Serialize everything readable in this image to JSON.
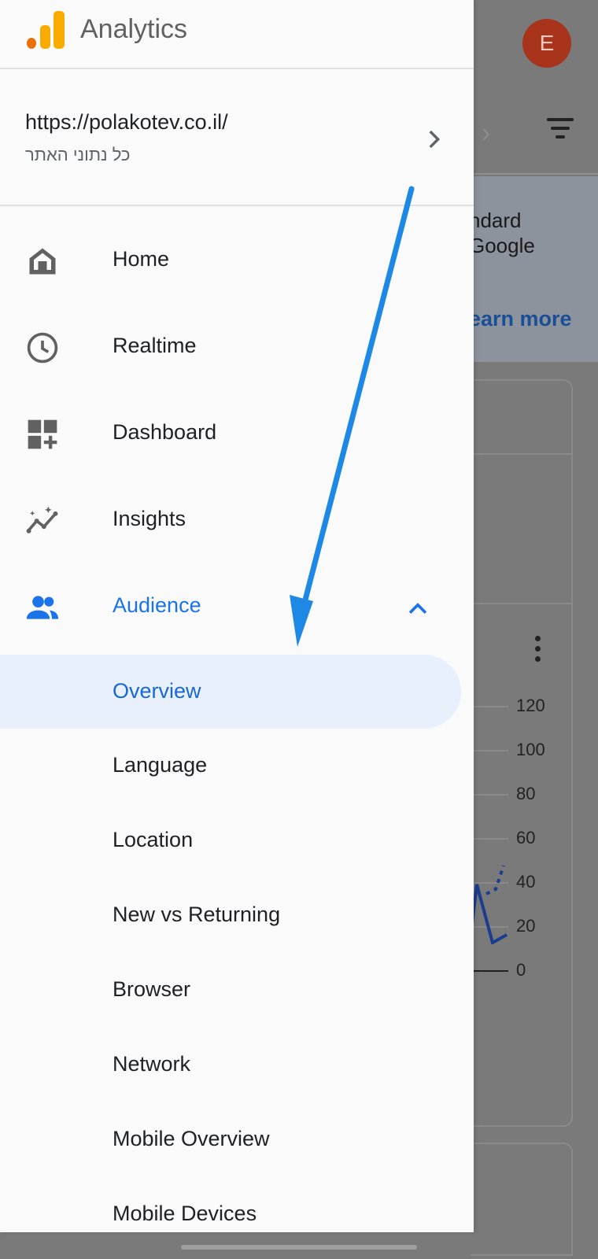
{
  "app": {
    "title": "Analytics",
    "avatar_initial": "E"
  },
  "account": {
    "url": "https://polakotev.co.il/",
    "view": "כל נתוני האתר"
  },
  "nav": {
    "home": "Home",
    "realtime": "Realtime",
    "dashboard": "Dashboard",
    "insights": "Insights",
    "audience": "Audience"
  },
  "audience_sub": {
    "overview": "Overview",
    "language": "Language",
    "location": "Location",
    "new_vs_returning": "New vs Returning",
    "browser": "Browser",
    "network": "Network",
    "mobile_overview": "Mobile Overview",
    "mobile_devices": "Mobile Devices"
  },
  "background": {
    "banner_text": "ndard\nGoogle",
    "banner_link": "earn more",
    "axis_ticks": [
      "120",
      "100",
      "80",
      "60",
      "40",
      "20",
      "0"
    ]
  },
  "colors": {
    "accent": "#1a73e8",
    "selected_bg": "#e8f0fe",
    "arrow": "#1e88e5",
    "avatar": "#a8341c"
  }
}
